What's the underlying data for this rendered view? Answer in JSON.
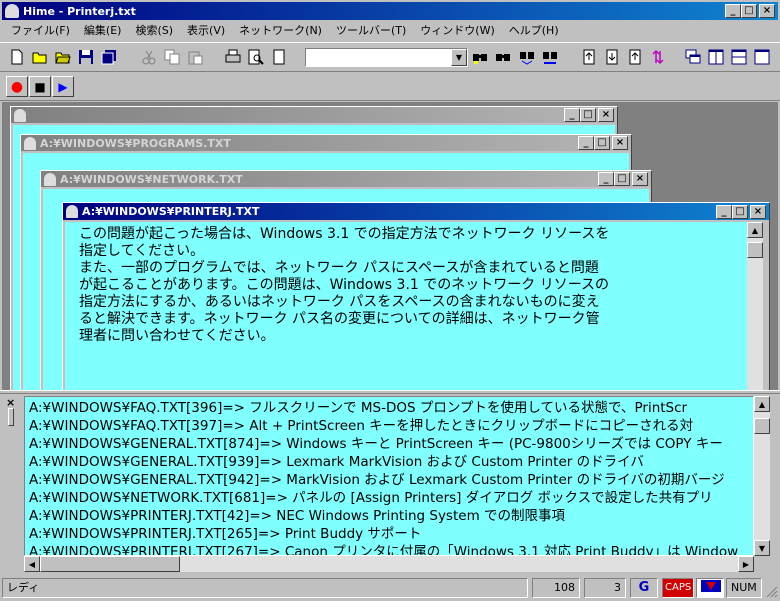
{
  "app": {
    "title": "Hime - Printerj.txt",
    "title_btns": {
      "min": "_",
      "max": "□",
      "close": "×"
    }
  },
  "menu": [
    "ファイル(F)",
    "編集(E)",
    "検索(S)",
    "表示(V)",
    "ネットワーク(N)",
    "ツールバー(T)",
    "ウィンドウ(W)",
    "ヘルプ(H)"
  ],
  "toolbar": {
    "combo_value": "",
    "combo_arrow": "▼"
  },
  "toolbar2": {
    "record": "●",
    "stop": "■",
    "play": "▶"
  },
  "windows": [
    {
      "title": ""
    },
    {
      "title": "A:¥WINDOWS¥PROGRAMS.TXT"
    },
    {
      "title": "A:¥WINDOWS¥NETWORK.TXT"
    },
    {
      "title": "A:¥WINDOWS¥PRINTERJ.TXT"
    }
  ],
  "document": {
    "lines": [
      "この問題が起こった場合は、Windows 3.1 での指定方法でネットワーク リソースを",
      "指定してください。",
      "",
      "また、一部のプログラムでは、ネットワーク パスにスペースが含まれていると問題",
      "が起こることがあります。この問題は、Windows 3.1 でのネットワーク リソースの",
      "指定方法にするか、あるいはネットワーク パスをスペースの含まれないものに変え",
      "ると解決できます。ネットワーク パス名の変更についての詳細は、ネットワーク管",
      "理者に問い合わせてください。"
    ]
  },
  "grep": {
    "lines": [
      "A:¥WINDOWS¥FAQ.TXT[396]=> フルスクリーンで MS-DOS プロンプトを使用している状態で、PrintScr",
      "A:¥WINDOWS¥FAQ.TXT[397]=> Alt + PrintScreen キーを押したときにクリップボードにコピーされる対",
      "A:¥WINDOWS¥GENERAL.TXT[874]=> Windows キーと PrintScreen キー (PC-9800シリーズでは COPY キー",
      "A:¥WINDOWS¥GENERAL.TXT[939]=> Lexmark MarkVision および Custom Printer のドライバ",
      "A:¥WINDOWS¥GENERAL.TXT[942]=> MarkVision および Lexmark Custom Printer のドライバの初期バージ",
      "A:¥WINDOWS¥NETWORK.TXT[681]=> パネルの [Assign Printers] ダイアログ ボックスで設定した共有プリ",
      "A:¥WINDOWS¥PRINTERJ.TXT[42]=> NEC Windows Printing System での制限事項",
      "A:¥WINDOWS¥PRINTERJ.TXT[265]=> Print Buddy サポート",
      "A:¥WINDOWS¥PRINTERJ.TXT[267]=> Canon プリンタに付属の「Windows 3.1 対応 Print Buddy」は Window"
    ],
    "close": "×"
  },
  "status": {
    "text": "レディ",
    "line": "108",
    "col": "3",
    "caps": "CAPS",
    "num": "NUM"
  },
  "colors": {
    "doc_bg": "#80ffff",
    "title_active": "#000080"
  }
}
